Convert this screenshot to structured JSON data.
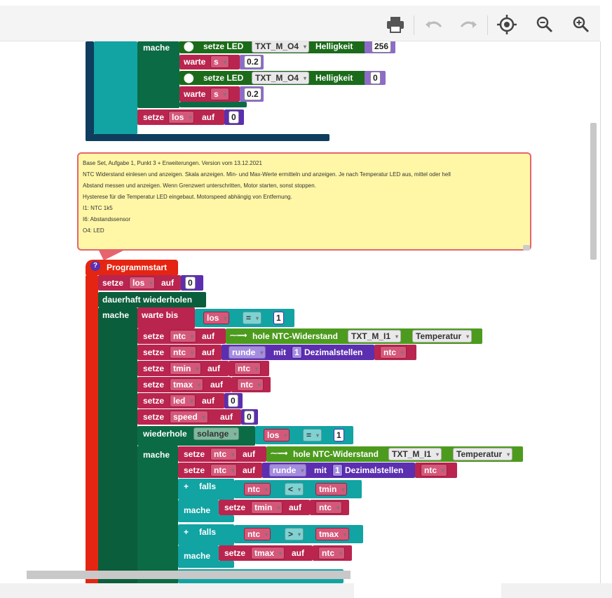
{
  "toolbar": {
    "icons": [
      "print-icon",
      "undo-icon",
      "redo-icon",
      "center-icon",
      "zoom-out-icon",
      "zoom-in-icon"
    ]
  },
  "blocks_top": {
    "mache": "mache",
    "setze_led": "setze LED",
    "txt_o4": "TXT_M_O4",
    "helligkeit": "Helligkeit",
    "val_256": "256",
    "warte": "warte",
    "unit_s": "s",
    "val_02": "0.2",
    "val_0": "0",
    "setze": "setze",
    "los": "los",
    "auf": "auf"
  },
  "comment": {
    "lines": [
      "Base Set, Aufgabe 1, Punkt 3 + Erweiterungen. Version  vom 13.12.2021",
      "NTC Widerstand einlesen und anzeigen. Skala anzeigen. Min- und Max-Werte ermitteln und anzeigen. Je nach Temperatur LED aus, mittel oder hell",
      "Abstand messen und anzeigen. Wenn Grenzwert unterschritten, Motor starten, sonst stoppen.",
      "Hysterese für die Temperatur LED eingebaut. Motorspeed abhängig von Entfernung.",
      "I1: NTC 1k5",
      "I6: Abstandssensor",
      "O4: LED"
    ]
  },
  "program": {
    "help": "?",
    "start": "Programmstart",
    "setze": "setze",
    "auf": "auf",
    "los": "los",
    "zero": "0",
    "one": "1",
    "forever": "dauerhaft wiederholen",
    "mache": "mache",
    "warte_bis": "warte bis",
    "eq": "=",
    "ntc": "ntc",
    "hole": "hole NTC-Widerstand",
    "txt_i1": "TXT_M_I1",
    "temperatur": "Temperatur",
    "runde": "runde",
    "mit": "mit",
    "dezimal": "Dezimalstellen",
    "tmin": "tmin",
    "tmax": "tmax",
    "led": "led",
    "speed": "speed",
    "wiederhole": "wiederhole",
    "solange": "solange",
    "plus": "+",
    "falls": "falls",
    "lt": "<",
    "gt": ">"
  },
  "colors": {
    "variable": "#b9254e",
    "loop": "#0b6b45",
    "loop_dark": "#0b5e3c",
    "logic": "#12a3a3",
    "led_block": "#1b6b1b",
    "number_led": "#8e6bc8",
    "math": "#5b2fb0",
    "sensor": "#4d9b1e",
    "event": "#e42512",
    "comment_bg": "#fff7a6",
    "comment_border": "#e6646e",
    "top_dark": "#0e3d5e"
  }
}
